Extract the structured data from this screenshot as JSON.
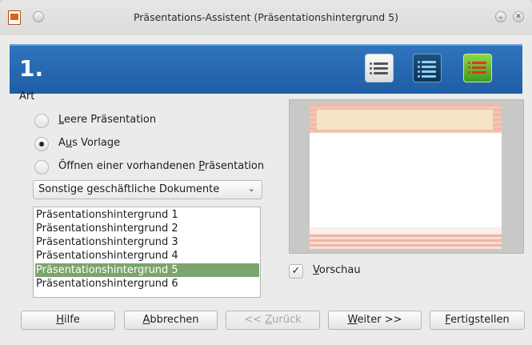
{
  "window": {
    "title": "Präsentations-Assistent (Präsentationshintergrund 5)",
    "app_icon": "impress-icon",
    "controls": [
      "minimize-icon",
      "close-icon"
    ]
  },
  "banner": {
    "step": "1.",
    "icons": [
      "list-icon-gray",
      "list-icon-blue",
      "list-icon-green"
    ],
    "colors": {
      "background": "#2a6db5"
    }
  },
  "art": {
    "label": "Art",
    "options": [
      {
        "pre": "",
        "mn": "L",
        "post": "eere Präsentation",
        "selected": false
      },
      {
        "pre": "A",
        "mn": "u",
        "post": "s Vorlage",
        "selected": true
      },
      {
        "pre": "Öffnen einer vorhandenen ",
        "mn": "P",
        "post": "räsentation",
        "selected": false
      }
    ]
  },
  "template_category": {
    "value": "Sonstige geschäftliche Dokumente"
  },
  "templates": {
    "items": [
      "Präsentationshintergrund 1",
      "Präsentationshintergrund 2",
      "Präsentationshintergrund 3",
      "Präsentationshintergrund 4",
      "Präsentationshintergrund 5",
      "Präsentationshintergrund 6"
    ],
    "selected_index": 4,
    "selection_color": "#7ba46e"
  },
  "preview": {
    "checkbox": {
      "pre": "",
      "mn": "V",
      "post": "orschau",
      "checked": true
    }
  },
  "buttons": {
    "help": {
      "pre": "",
      "mn": "H",
      "post": "ilfe"
    },
    "cancel": {
      "pre": "",
      "mn": "A",
      "post": "bbrechen"
    },
    "back": {
      "pre": "<< ",
      "mn": "Z",
      "post": "urück",
      "enabled": false
    },
    "next": {
      "pre": "",
      "mn": "W",
      "post": "eiter >>"
    },
    "finish": {
      "pre": "",
      "mn": "F",
      "post": "ertigstellen"
    }
  }
}
